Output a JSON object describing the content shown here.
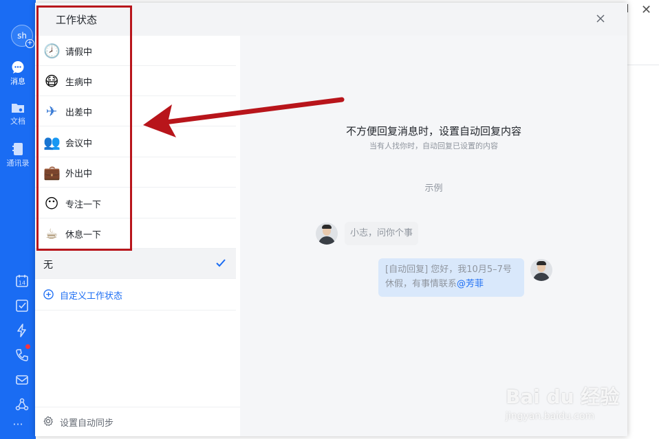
{
  "app": {
    "avatar_text": "sh",
    "nav": [
      {
        "label": "消息",
        "icon": "chat-bubble-icon"
      },
      {
        "label": "文档",
        "icon": "folder-icon"
      },
      {
        "label": "通讯录",
        "icon": "contacts-icon"
      }
    ],
    "tools": [
      "calendar-icon",
      "task-check-icon",
      "lightning-icon",
      "phone-icon",
      "mail-icon",
      "network-icon",
      "more-icon"
    ],
    "calendar_day": "14",
    "more_glyph": "···"
  },
  "dialog": {
    "title": "工作状态",
    "statuses": [
      {
        "label": "请假中",
        "emoji": "🕗"
      },
      {
        "label": "生病中",
        "emoji": "😷"
      },
      {
        "label": "出差中",
        "emoji": "✈"
      },
      {
        "label": "会议中",
        "emoji": "👥"
      },
      {
        "label": "外出中",
        "emoji": "💼"
      },
      {
        "label": "专注一下",
        "emoji": "😶"
      },
      {
        "label": "休息一下",
        "emoji": "☕"
      }
    ],
    "none_label": "无",
    "custom_label": "自定义工作状态",
    "sync_label": "设置自动同步",
    "hint_title": "不方便回复消息时，设置自动回复内容",
    "hint_sub": "当有人找你时，自动回复已设置的内容",
    "example_label": "示例",
    "chat": {
      "incoming": "小志，问你个事",
      "reply_line1": "[自动回复] 您好，我10月5–7号",
      "reply_line2_prefix": "休假，有事情联系",
      "reply_mention": "@芳菲"
    }
  },
  "watermark": {
    "text": "Bai du 经验",
    "sub": "jingyan.baidu.com"
  },
  "colors": {
    "accent": "#1a6cf3",
    "annotation": "#b8151b"
  }
}
